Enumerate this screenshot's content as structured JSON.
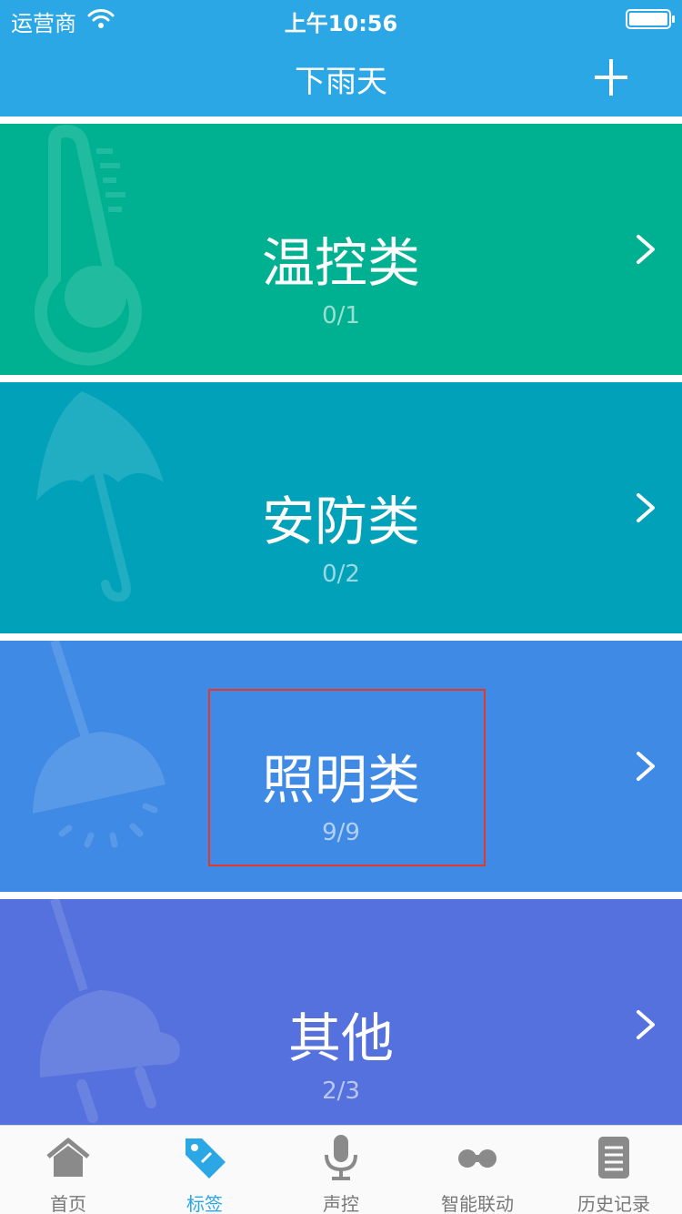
{
  "status_bar": {
    "carrier": "运营商",
    "time": "上午10:56"
  },
  "nav": {
    "title": "下雨天"
  },
  "categories": [
    {
      "name": "温控类",
      "count": "0/1",
      "icon": "thermometer-icon",
      "color": "#00b191"
    },
    {
      "name": "安防类",
      "count": "0/2",
      "icon": "umbrella-icon",
      "color": "#00a1b9"
    },
    {
      "name": "照明类",
      "count": "9/9",
      "icon": "lamp-icon",
      "color": "#3f8ae5"
    },
    {
      "name": "其他",
      "count": "2/3",
      "icon": "plug-icon",
      "color": "#5471dd"
    }
  ],
  "tabs": [
    {
      "label": "首页",
      "icon": "home-icon",
      "active": false
    },
    {
      "label": "标签",
      "icon": "tag-icon",
      "active": true
    },
    {
      "label": "声控",
      "icon": "microphone-icon",
      "active": false
    },
    {
      "label": "智能联动",
      "icon": "link-icon",
      "active": false
    },
    {
      "label": "历史记录",
      "icon": "history-icon",
      "active": false
    }
  ],
  "colors": {
    "header": "#2aa7e4",
    "active_tab": "#2aa7e4",
    "inactive_tab": "#777777",
    "highlight": "#e2392b"
  }
}
